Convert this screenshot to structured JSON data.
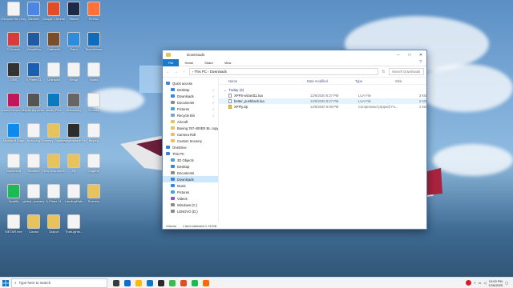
{
  "desktop": {
    "icons": [
      {
        "label": "Recycle Bin (empty)"
      },
      {
        "label": "Blender"
      },
      {
        "label": "Google Chrome"
      },
      {
        "label": "Steam"
      },
      {
        "label": "Firefox"
      },
      {
        "label": "CCleaner"
      },
      {
        "label": "VirtualBox"
      },
      {
        "label": "Calibre64"
      },
      {
        "label": "Paint"
      },
      {
        "label": "TeamViewer"
      },
      {
        "label": "OBS"
      },
      {
        "label": "X-Plane 11"
      },
      {
        "label": "Uninstall"
      },
      {
        "label": "Setup"
      },
      {
        "label": "Notes"
      },
      {
        "label": "Avast Secure Browser"
      },
      {
        "label": "Cydia Impactor"
      },
      {
        "label": "Audio Pilot"
      },
      {
        "label": "Autoconfig"
      },
      {
        "label": "Thumbs"
      },
      {
        "label": "Microsoft Edge"
      },
      {
        "label": "bmw.png"
      },
      {
        "label": "Scenery Gateway"
      },
      {
        "label": "Wondershare Filmora X"
      },
      {
        "label": "ffmpeg"
      },
      {
        "label": "Document"
      },
      {
        "label": "Readme"
      },
      {
        "label": "New Document"
      },
      {
        "label": "Zip"
      },
      {
        "label": "Lagtest"
      },
      {
        "label": "Spotify"
      },
      {
        "label": "global_scenery"
      },
      {
        "label": "X-Plane 11"
      },
      {
        "label": "LandingRate"
      },
      {
        "label": "Scenery"
      },
      {
        "label": "METAR.exe"
      },
      {
        "label": "Conan"
      },
      {
        "label": "Output"
      },
      {
        "label": "TrueLights..."
      }
    ]
  },
  "explorer": {
    "title": "Downloads",
    "tabs": [
      "File",
      "Home",
      "Share",
      "View"
    ],
    "breadcrumb": "› This PC › Downloads",
    "search_placeholder": "Search Downloads",
    "columns": [
      "Name",
      "Date modified",
      "Type",
      "Size"
    ],
    "group": "Today (3)",
    "files": [
      {
        "name": "XPPS-wizard11.lua",
        "date": "12/6/2020 8:37 PM",
        "type": "LUA File",
        "size": "3 KB"
      },
      {
        "name": "better_pushback.lua",
        "date": "12/6/2020 8:37 PM",
        "type": "LUA File",
        "size": "2 KB"
      },
      {
        "name": "XPFly.zip",
        "date": "12/6/2020 8:08 PM",
        "type": "Compressed (zipped) Fo...",
        "size": "1 KB"
      }
    ],
    "nav": [
      {
        "label": "Quick access",
        "level": 0,
        "color": "#3b84d9",
        "pin": ""
      },
      {
        "label": "Desktop",
        "level": 1,
        "color": "#3b84d9",
        "pin": "✓"
      },
      {
        "label": "Downloads",
        "level": 1,
        "color": "#3b84d9",
        "pin": "✓"
      },
      {
        "label": "Documents",
        "level": 1,
        "color": "#8a8a8a",
        "pin": "✓"
      },
      {
        "label": "Pictures",
        "level": 1,
        "color": "#4aa0d8",
        "pin": "✓"
      },
      {
        "label": "Recycle Bin",
        "level": 1,
        "color": "#7ba4c7",
        "pin": "✓"
      },
      {
        "label": "Aircraft",
        "level": 1,
        "color": "#e8c25a",
        "pin": ""
      },
      {
        "label": "Boeing 767-400ER BL copy",
        "level": 1,
        "color": "#e8c25a",
        "pin": ""
      },
      {
        "label": "Camera Roll",
        "level": 1,
        "color": "#e8c25a",
        "pin": ""
      },
      {
        "label": "Custom Scenery",
        "level": 1,
        "color": "#e8c25a",
        "pin": ""
      },
      {
        "label": "OneDrive",
        "level": 0,
        "color": "#2f7ed8",
        "pin": ""
      },
      {
        "label": "This PC",
        "level": 0,
        "color": "#3b84d9",
        "pin": ""
      },
      {
        "label": "3D Objects",
        "level": 1,
        "color": "#4aa0d8",
        "pin": ""
      },
      {
        "label": "Desktop",
        "level": 1,
        "color": "#3b84d9",
        "pin": ""
      },
      {
        "label": "Documents",
        "level": 1,
        "color": "#8a8a8a",
        "pin": ""
      },
      {
        "label": "Downloads",
        "level": 1,
        "color": "#3b84d9",
        "pin": "",
        "selected": true
      },
      {
        "label": "Music",
        "level": 1,
        "color": "#3b84d9",
        "pin": ""
      },
      {
        "label": "Pictures",
        "level": 1,
        "color": "#4aa0d8",
        "pin": ""
      },
      {
        "label": "Videos",
        "level": 1,
        "color": "#7b5ec7",
        "pin": ""
      },
      {
        "label": "Windows (C:)",
        "level": 1,
        "color": "#8a8a8a",
        "pin": ""
      },
      {
        "label": "LENOVO (D:)",
        "level": 1,
        "color": "#8a8a8a",
        "pin": ""
      }
    ],
    "status_items": "4 items",
    "status_selected": "1 item selected  1.78 KB"
  },
  "taskbar": {
    "search_placeholder": "Type here to search",
    "apps": [
      {
        "color": "#3a3a3a"
      },
      {
        "color": "#0a6dd1"
      },
      {
        "color": "#ffb900"
      },
      {
        "color": "#0b78d0"
      },
      {
        "color": "#2a2a2a"
      },
      {
        "color": "#3cba54"
      },
      {
        "color": "#e34d26"
      },
      {
        "color": "#1db954"
      },
      {
        "color": "#ff6a00"
      }
    ],
    "time": "10:00 PM",
    "date": "12/6/2020"
  }
}
